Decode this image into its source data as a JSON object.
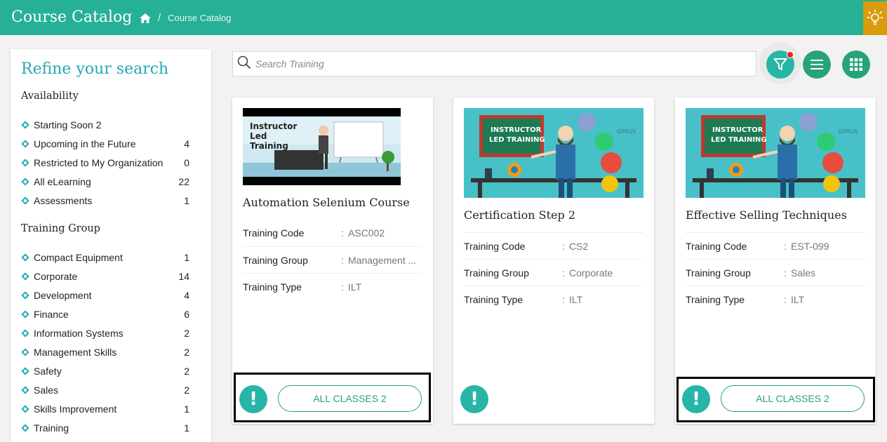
{
  "header": {
    "title": "Course Catalog",
    "breadcrumb_sep": "/",
    "breadcrumb_current": "Course Catalog"
  },
  "sidebar": {
    "heading": "Refine your search",
    "availability": {
      "title": "Availability",
      "items": [
        {
          "label": "Starting Soon 2",
          "count": ""
        },
        {
          "label": "Upcoming in the Future",
          "count": "4"
        },
        {
          "label": "Restricted to My Organization",
          "count": "0"
        },
        {
          "label": "All eLearning",
          "count": "22"
        },
        {
          "label": "Assessments",
          "count": "1"
        }
      ]
    },
    "training_group": {
      "title": "Training Group",
      "items": [
        {
          "label": "Compact Equipment",
          "count": "1"
        },
        {
          "label": "Corporate",
          "count": "14"
        },
        {
          "label": "Development",
          "count": "4"
        },
        {
          "label": "Finance",
          "count": "6"
        },
        {
          "label": "Information Systems",
          "count": "2"
        },
        {
          "label": "Management Skills",
          "count": "2"
        },
        {
          "label": "Safety",
          "count": "2"
        },
        {
          "label": "Sales",
          "count": "2"
        },
        {
          "label": "Skills Improvement",
          "count": "1"
        },
        {
          "label": "Training",
          "count": "1"
        }
      ]
    }
  },
  "search": {
    "placeholder": "Search Training"
  },
  "icons": {
    "home": "home-icon",
    "bulb": "lightbulb-icon",
    "search": "search-icon",
    "filter": "filter-icon",
    "list": "list-view-icon",
    "grid": "grid-view-icon",
    "info": "info-icon"
  },
  "colors": {
    "header": "#26b095",
    "accent": "#26a7b5",
    "button": "#26a37a",
    "bulb": "#d89c0c",
    "alert_dot": "#ff1a1a"
  },
  "cards": [
    {
      "image_text": "Instructor Led Training",
      "title": "Automation Selenium Course",
      "fields": [
        {
          "label": "Training Code",
          "value": "ASC002"
        },
        {
          "label": "Training Group",
          "value": "Management ..."
        },
        {
          "label": "Training Type",
          "value": "ILT"
        }
      ],
      "info": "!",
      "classes_button": "ALL CLASSES 2"
    },
    {
      "image_text": "INSTRUCTOR LED TRAINING",
      "image_brand": "GYRUS",
      "title": "Certification Step 2",
      "fields": [
        {
          "label": "Training Code",
          "value": "CS2"
        },
        {
          "label": "Training Group",
          "value": "Corporate"
        },
        {
          "label": "Training Type",
          "value": "ILT"
        }
      ],
      "info": "!"
    },
    {
      "image_text": "INSTRUCTOR LED TRAINING",
      "image_brand": "GYRUS",
      "title": "Effective Selling Techniques",
      "fields": [
        {
          "label": "Training Code",
          "value": "EST-099"
        },
        {
          "label": "Training Group",
          "value": "Sales"
        },
        {
          "label": "Training Type",
          "value": "ILT"
        }
      ],
      "info": "!",
      "classes_button": "ALL CLASSES 2"
    }
  ]
}
